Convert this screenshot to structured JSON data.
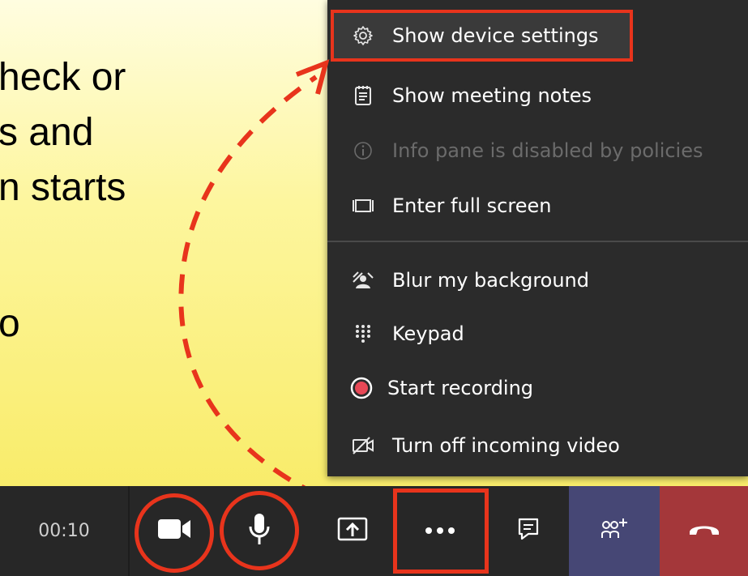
{
  "slide": {
    "lines": [
      "heck or",
      "s and",
      "n starts",
      "o"
    ]
  },
  "menu": {
    "items": [
      {
        "label": "Show device settings",
        "icon": "gear-icon",
        "enabled": true,
        "highlighted": true
      },
      {
        "label": "Show meeting notes",
        "icon": "notes-icon",
        "enabled": true
      },
      {
        "label": "Info pane is disabled by policies",
        "icon": "info-icon",
        "enabled": false
      },
      {
        "label": "Enter full screen",
        "icon": "fullscreen-icon",
        "enabled": true
      },
      {
        "label": "Blur my background",
        "icon": "blur-background-icon",
        "enabled": true
      },
      {
        "label": "Keypad",
        "icon": "keypad-icon",
        "enabled": true
      },
      {
        "label": "Start recording",
        "icon": "record-icon",
        "enabled": true
      },
      {
        "label": "Turn off incoming video",
        "icon": "video-off-icon",
        "enabled": true
      }
    ]
  },
  "toolbar": {
    "timer": "00:10",
    "buttons": [
      "camera-icon",
      "microphone-icon",
      "share-screen-icon",
      "more-options-icon",
      "chat-icon",
      "participants-icon",
      "hang-up-icon"
    ]
  },
  "colors": {
    "highlight": "#e8341c",
    "menu_bg": "#2b2b2b",
    "toolbar_bg": "#272727",
    "participants_bg": "#464775",
    "hangup_bg": "#a4373a",
    "record_red": "#e74856"
  }
}
